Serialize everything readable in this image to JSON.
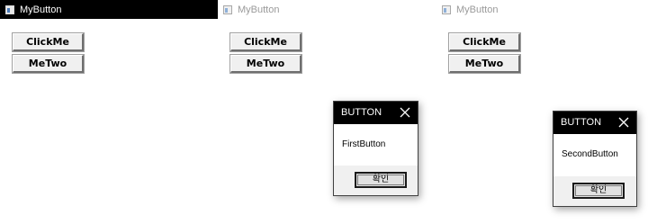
{
  "windows": [
    {
      "title": "MyButton",
      "state": "active",
      "buttons": [
        {
          "label": "ClickMe"
        },
        {
          "label": "MeTwo"
        }
      ]
    },
    {
      "title": "MyButton",
      "state": "inactive",
      "buttons": [
        {
          "label": "ClickMe"
        },
        {
          "label": "MeTwo"
        }
      ],
      "dialog": {
        "title": "BUTTON",
        "message": "FirstButton",
        "ok_label": "확인"
      }
    },
    {
      "title": "MyButton",
      "state": "inactive",
      "buttons": [
        {
          "label": "ClickMe"
        },
        {
          "label": "MeTwo"
        }
      ],
      "dialog": {
        "title": "BUTTON",
        "message": "SecondButton",
        "ok_label": "확인"
      }
    }
  ],
  "icons": {
    "app_icon": "window-app-icon",
    "close_icon": "close-x-icon"
  },
  "colors": {
    "active_titlebar": "#000000",
    "inactive_title_text": "#9a9a9a",
    "button_face": "#f0f0f0",
    "dialog_footer": "#f0f0f0"
  }
}
